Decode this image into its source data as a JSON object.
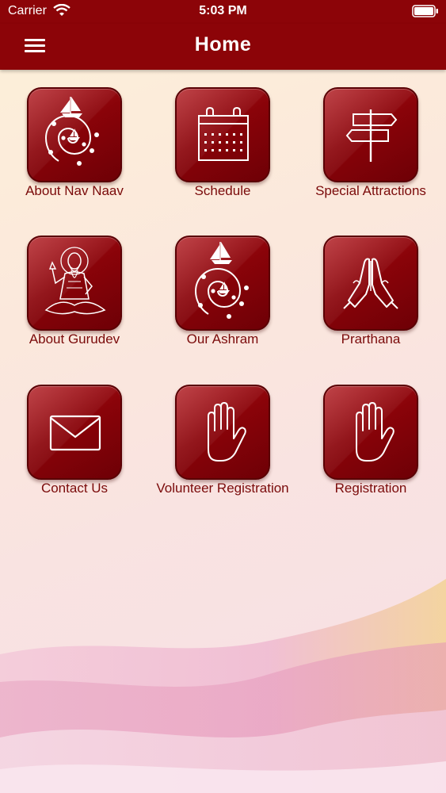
{
  "status_bar": {
    "carrier": "Carrier",
    "time": "5:03 PM",
    "wifi_icon": "wifi-icon",
    "battery_icon": "battery-icon"
  },
  "nav": {
    "title": "Home",
    "menu_icon": "hamburger-menu-icon"
  },
  "tiles": [
    {
      "label": "About Nav Naav",
      "icon": "spiral-boat-icon"
    },
    {
      "label": "Schedule",
      "icon": "calendar-icon"
    },
    {
      "label": "Special Attractions",
      "icon": "signpost-icon"
    },
    {
      "label": "About Gurudev",
      "icon": "guru-figure-icon"
    },
    {
      "label": "Our Ashram",
      "icon": "spiral-boat-icon"
    },
    {
      "label": "Prarthana",
      "icon": "praying-hands-icon"
    },
    {
      "label": "Contact Us",
      "icon": "envelope-icon"
    },
    {
      "label": "Volunteer Registration",
      "icon": "raised-hand-icon"
    },
    {
      "label": "Registration",
      "icon": "raised-hand-icon"
    }
  ],
  "colors": {
    "header": "#8c0408",
    "tile": "#8a0309",
    "label_text": "#7a0a0a"
  }
}
